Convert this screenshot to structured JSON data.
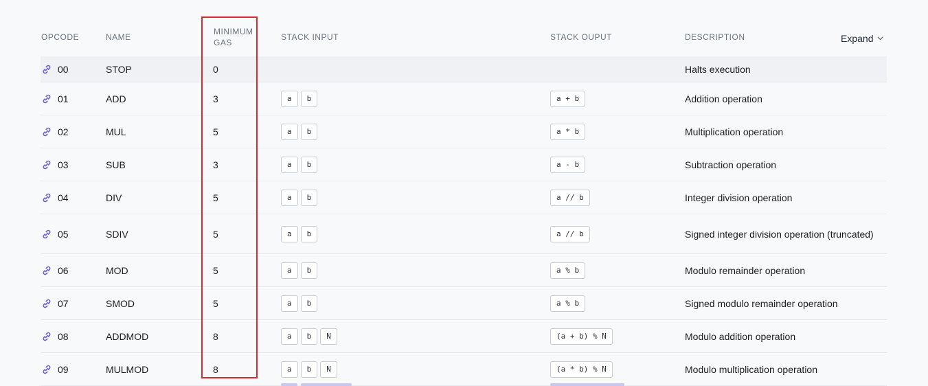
{
  "header": {
    "opcode": "OPCODE",
    "name": "NAME",
    "gas_line1": "MINIMUM",
    "gas_line2": "GAS",
    "stack_input": "STACK INPUT",
    "stack_output": "STACK OUPUT",
    "description": "DESCRIPTION",
    "expand_label": "Expand"
  },
  "icons": {
    "row_link": "link-icon",
    "expand": "chevron-down-icon"
  },
  "colors": {
    "highlight": "#d62b31",
    "link_icon": "#6d63c9"
  },
  "rows": [
    {
      "opcode": "00",
      "name": "STOP",
      "gas": "0",
      "inputs": [],
      "output": "",
      "desc": "Halts execution"
    },
    {
      "opcode": "01",
      "name": "ADD",
      "gas": "3",
      "inputs": [
        "a",
        "b"
      ],
      "output": "a + b",
      "desc": "Addition operation"
    },
    {
      "opcode": "02",
      "name": "MUL",
      "gas": "5",
      "inputs": [
        "a",
        "b"
      ],
      "output": "a * b",
      "desc": "Multiplication operation"
    },
    {
      "opcode": "03",
      "name": "SUB",
      "gas": "3",
      "inputs": [
        "a",
        "b"
      ],
      "output": "a - b",
      "desc": "Subtraction operation"
    },
    {
      "opcode": "04",
      "name": "DIV",
      "gas": "5",
      "inputs": [
        "a",
        "b"
      ],
      "output": "a // b",
      "desc": "Integer division operation"
    },
    {
      "opcode": "05",
      "name": "SDIV",
      "gas": "5",
      "inputs": [
        "a",
        "b"
      ],
      "output": "a // b",
      "desc": "Signed integer division operation (truncated)"
    },
    {
      "opcode": "06",
      "name": "MOD",
      "gas": "5",
      "inputs": [
        "a",
        "b"
      ],
      "output": "a % b",
      "desc": "Modulo remainder operation"
    },
    {
      "opcode": "07",
      "name": "SMOD",
      "gas": "5",
      "inputs": [
        "a",
        "b"
      ],
      "output": "a % b",
      "desc": "Signed modulo remainder operation"
    },
    {
      "opcode": "08",
      "name": "ADDMOD",
      "gas": "8",
      "inputs": [
        "a",
        "b",
        "N"
      ],
      "output": "(a + b) % N",
      "desc": "Modulo addition operation"
    },
    {
      "opcode": "09",
      "name": "MULMOD",
      "gas": "8",
      "inputs": [
        "a",
        "b",
        "N"
      ],
      "output": "(a * b) % N",
      "desc": "Modulo multiplication operation"
    }
  ]
}
